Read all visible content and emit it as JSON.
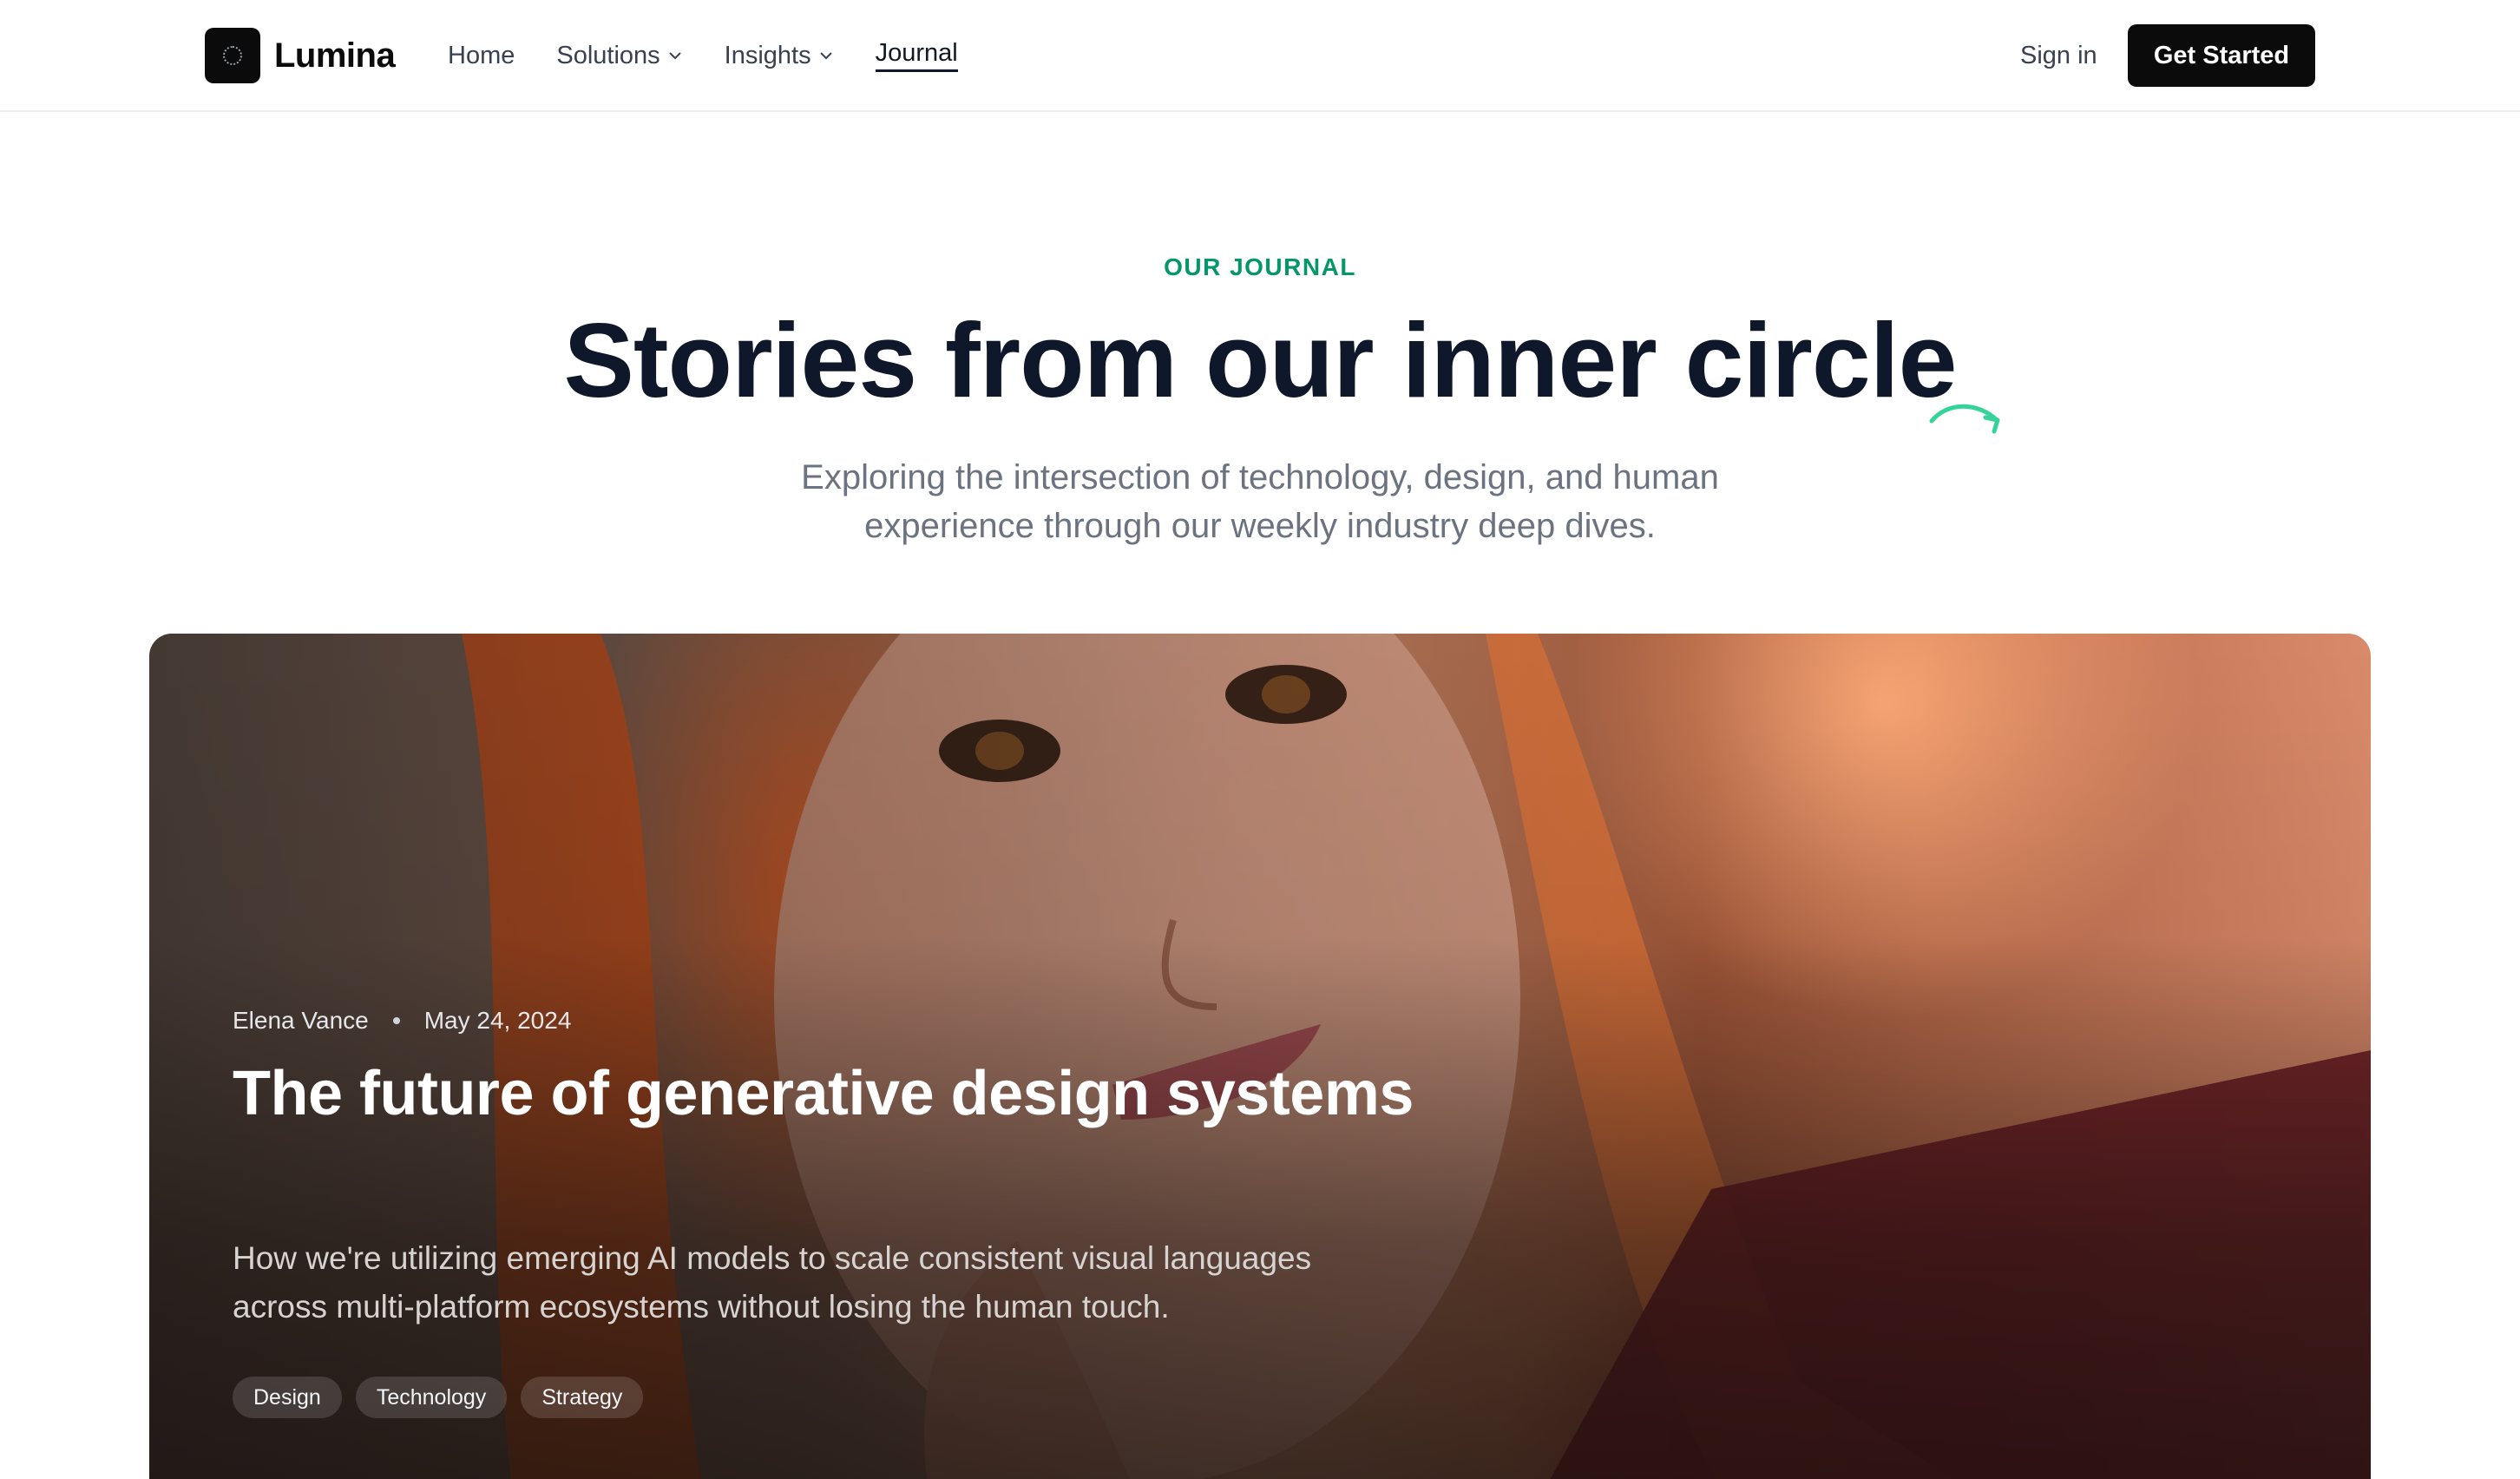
{
  "brand": {
    "name": "Lumina"
  },
  "nav": {
    "items": [
      {
        "label": "Home",
        "dropdown": false,
        "active": false
      },
      {
        "label": "Solutions",
        "dropdown": true,
        "active": false
      },
      {
        "label": "Insights",
        "dropdown": true,
        "active": false
      },
      {
        "label": "Journal",
        "dropdown": false,
        "active": true
      }
    ],
    "sign_in": "Sign in",
    "cta": "Get Started"
  },
  "hero": {
    "eyebrow": "OUR JOURNAL",
    "title": "Stories from our inner circle",
    "subtitle": "Exploring the intersection of technology, design, and human experience through our weekly industry deep dives."
  },
  "featured": {
    "author": "Elena Vance",
    "date": "May 24, 2024",
    "title": "The future of generative design systems",
    "description": "How we're utilizing emerging AI models to scale consistent visual languages across multi-platform ecosystems without losing the human touch.",
    "tags": [
      "Design",
      "Technology",
      "Strategy"
    ]
  },
  "icons": {
    "logo": "logo-mark-icon",
    "dropdown": "chevron-down-icon",
    "accent": "swoosh-arrow-icon"
  },
  "colors": {
    "accent": "#059669",
    "swoosh": "#34d399",
    "primary": "#0b0b0c",
    "heading": "#0f172a",
    "muted": "#6b7280"
  }
}
